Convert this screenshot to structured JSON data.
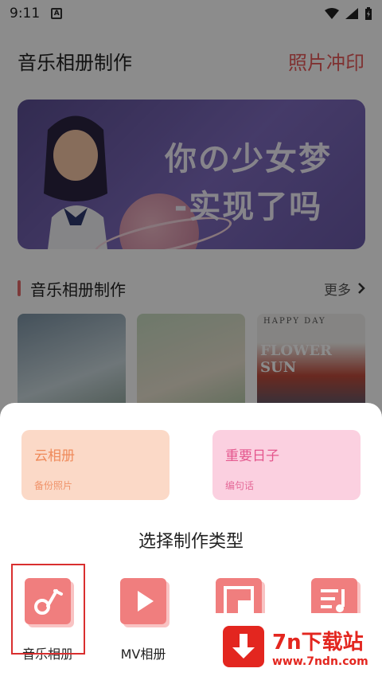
{
  "status": {
    "time": "9:11"
  },
  "header": {
    "title": "音乐相册制作",
    "link": "照片冲印"
  },
  "banner": {
    "line1": "你の少女梦",
    "line2": "-实现了吗"
  },
  "section": {
    "title": "音乐相册制作",
    "more": "更多"
  },
  "thumbs": {
    "t3_top": "HAPPY DAY",
    "t3_mid": "FLOWER SUN"
  },
  "sheet": {
    "cards": [
      {
        "title": "云相册",
        "sub": "备份照片"
      },
      {
        "title": "重要日子",
        "sub": "编句话"
      }
    ],
    "choose_title": "选择制作类型",
    "types": [
      {
        "label": "音乐相册",
        "selected": true
      },
      {
        "label": "MV相册",
        "selected": false
      }
    ]
  },
  "watermark": {
    "title": "7n下载站",
    "url": "www.7ndn.com"
  },
  "colors": {
    "accent": "#e75a5a",
    "icon": "#f07e7e",
    "highlight": "#d92f2f",
    "watermark": "#e3261f"
  }
}
